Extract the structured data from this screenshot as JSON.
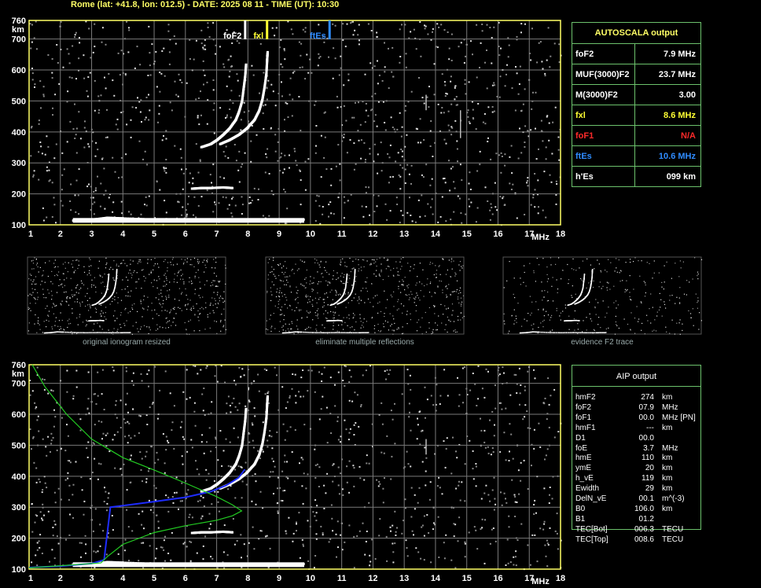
{
  "header": "Rome (lat: +41.8, lon: 012.5) - DATE: 2025 08 11 - TIME (UT): 10:30",
  "axis": {
    "y_unit": "km",
    "x_unit": "MHz",
    "y_ticks": [
      "760",
      "700",
      "600",
      "500",
      "400",
      "300",
      "200",
      "100"
    ],
    "x_ticks": [
      "1",
      "2",
      "3",
      "4",
      "5",
      "6",
      "7",
      "8",
      "9",
      "10",
      "11",
      "12",
      "13",
      "14",
      "15",
      "16",
      "17",
      "18"
    ]
  },
  "markers": {
    "foF2": "foF2",
    "fxl": "fxl",
    "ftEs": "ftEs"
  },
  "colors": {
    "frame": "#ffff66",
    "grid": "#7a7a7a",
    "table_border": "#6cc26c",
    "fxl": "#ffff33",
    "foF1": "#ff2a2a",
    "ftEs": "#2f8cff",
    "profile": "#1e2cff",
    "model": "#22cc22"
  },
  "autoscala": {
    "title": "AUTOSCALA output",
    "rows": [
      {
        "key": "foF2",
        "value": "7.9 MHz"
      },
      {
        "key": "MUF(3000)F2",
        "value": "23.7 MHz"
      },
      {
        "key": "M(3000)F2",
        "value": "3.00"
      },
      {
        "key": "fxl",
        "value": "8.6 MHz"
      },
      {
        "key": "foF1",
        "value": "N/A"
      },
      {
        "key": "ftEs",
        "value": "10.6 MHz"
      },
      {
        "key": "h'Es",
        "value": "099    km"
      }
    ]
  },
  "aip": {
    "title": "AIP output",
    "rows": [
      {
        "k": "hmF2",
        "v": "274",
        "u": "km"
      },
      {
        "k": "foF2",
        "v": "07.9",
        "u": "MHz"
      },
      {
        "k": "foF1",
        "v": "00.0",
        "u": "MHz   [PN]"
      },
      {
        "k": "hmF1",
        "v": "---",
        "u": "km"
      },
      {
        "k": "D1",
        "v": "00.0",
        "u": ""
      },
      {
        "k": "foE",
        "v": "3.7",
        "u": "MHz"
      },
      {
        "k": "hmE",
        "v": "110",
        "u": "km"
      },
      {
        "k": "ymE",
        "v": "20",
        "u": "km"
      },
      {
        "k": "h_vE",
        "v": "119",
        "u": "km"
      },
      {
        "k": "Ewidth",
        "v": "29",
        "u": "km"
      },
      {
        "k": "DelN_vE",
        "v": "00.1",
        "u": "m^(-3)"
      },
      {
        "k": "B0",
        "v": "106.0",
        "u": "km"
      },
      {
        "k": "B1",
        "v": "01.2",
        "u": ""
      },
      {
        "k": "TEC[Bot]",
        "v": "006.3",
        "u": "TECU"
      },
      {
        "k": "TEC[Top]",
        "v": "008.6",
        "u": "TECU"
      }
    ]
  },
  "thumbnails": [
    "original ionogram resized",
    "eliminate multiple reflections",
    "evidence F2 trace"
  ],
  "chart_data": [
    {
      "type": "scatter",
      "title": "",
      "xlabel": "MHz",
      "ylabel": "km",
      "xlim": [
        1,
        18
      ],
      "ylim": [
        100,
        760
      ],
      "series": [
        {
          "name": "",
          "points": [
            [
              6.5,
              352
            ],
            [
              6.8,
              362
            ],
            [
              7.0,
              375
            ],
            [
              7.2,
              392
            ],
            [
              7.4,
              412
            ],
            [
              7.6,
              440
            ],
            [
              7.7,
              465
            ],
            [
              7.8,
              500
            ],
            [
              7.85,
              540
            ],
            [
              7.9,
              580
            ],
            [
              7.93,
              620
            ]
          ]
        },
        {
          "name": "",
          "points": [
            [
              7.1,
              362
            ],
            [
              7.4,
              375
            ],
            [
              7.7,
              392
            ],
            [
              7.95,
              412
            ],
            [
              8.2,
              440
            ],
            [
              8.35,
              470
            ],
            [
              8.45,
              505
            ],
            [
              8.52,
              545
            ],
            [
              8.58,
              590
            ],
            [
              8.6,
              630
            ],
            [
              8.62,
              660
            ]
          ]
        },
        {
          "name": "",
          "points": [
            [
              6.2,
              218
            ],
            [
              6.5,
              220
            ],
            [
              6.8,
              220
            ],
            [
              7.2,
              222
            ],
            [
              7.5,
              220
            ]
          ]
        },
        {
          "name": "",
          "points": [
            [
              2.4,
              115
            ],
            [
              3,
              118
            ],
            [
              3.5,
              124
            ],
            [
              4,
              122
            ],
            [
              5,
              118
            ],
            [
              6,
              117
            ],
            [
              7,
              118
            ],
            [
              8,
              117
            ],
            [
              9,
              117
            ],
            [
              9.8,
              118
            ]
          ]
        }
      ],
      "markers": {
        "foF2": 7.9,
        "fxl": 8.6,
        "ftEs": 10.6
      }
    },
    {
      "type": "line",
      "title": "",
      "xlabel": "MHz",
      "ylabel": "km",
      "xlim": [
        1,
        18
      ],
      "ylim": [
        100,
        760
      ],
      "series": [
        {
          "name": "",
          "points": [
            [
              1.0,
              105
            ],
            [
              2.0,
              110
            ],
            [
              3.0,
              118
            ],
            [
              3.4,
              130
            ],
            [
              3.6,
              300
            ],
            [
              4.0,
              305
            ],
            [
              5.0,
              318
            ],
            [
              6.0,
              332
            ],
            [
              6.8,
              350
            ],
            [
              7.3,
              370
            ],
            [
              7.7,
              395
            ],
            [
              7.9,
              422
            ]
          ]
        },
        {
          "name": "",
          "points": [
            [
              1.1,
              760
            ],
            [
              1.5,
              690
            ],
            [
              2.2,
              600
            ],
            [
              3.0,
              520
            ],
            [
              4.0,
              460
            ],
            [
              5.0,
              420
            ],
            [
              6.0,
              378
            ],
            [
              7.0,
              334
            ],
            [
              7.5,
              308
            ],
            [
              7.8,
              288
            ],
            [
              7.5,
              272
            ],
            [
              7.0,
              258
            ],
            [
              6.0,
              240
            ],
            [
              5.0,
              218
            ],
            [
              4.0,
              180
            ],
            [
              3.5,
              140
            ],
            [
              3.3,
              120
            ],
            [
              1.0,
              104
            ]
          ]
        }
      ]
    }
  ]
}
